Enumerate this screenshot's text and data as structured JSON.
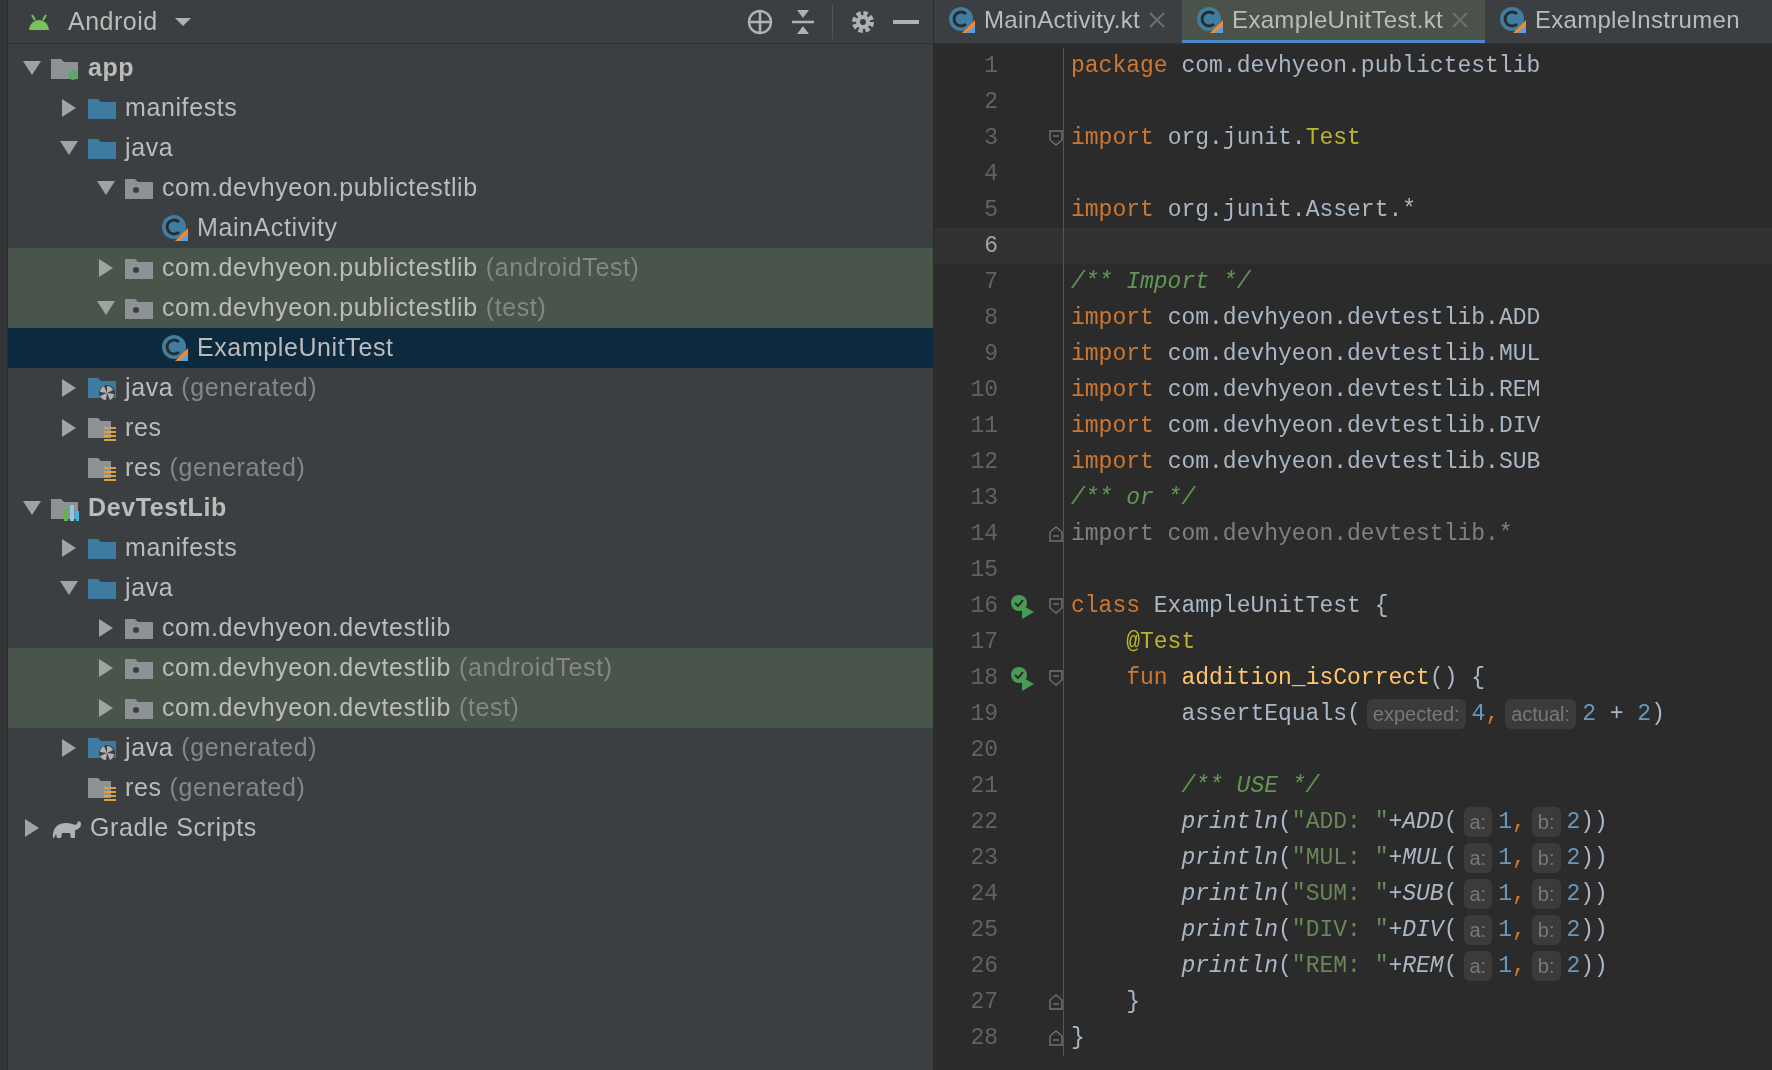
{
  "project_panel": {
    "view": "Android",
    "tree": [
      {
        "label": "app",
        "bold": true,
        "kind": "module",
        "expanded": true,
        "selected": false,
        "tinted": false,
        "children": [
          {
            "label": "manifests",
            "kind": "folder",
            "expanded": false,
            "selected": false,
            "tinted": false
          },
          {
            "label": "java",
            "kind": "folder",
            "expanded": true,
            "selected": false,
            "tinted": false,
            "children": [
              {
                "label": "com.devhyeon.publictestlib",
                "kind": "package",
                "expanded": true,
                "selected": false,
                "tinted": false,
                "children": [
                  {
                    "label": "MainActivity",
                    "kind": "class",
                    "selected": false,
                    "tinted": false
                  }
                ]
              },
              {
                "label": "com.devhyeon.publictestlib",
                "suffix": "(androidTest)",
                "kind": "package",
                "expanded": false,
                "selected": false,
                "tinted": true
              },
              {
                "label": "com.devhyeon.publictestlib",
                "suffix": "(test)",
                "kind": "package",
                "expanded": true,
                "selected": false,
                "tinted": true,
                "children": [
                  {
                    "label": "ExampleUnitTest",
                    "kind": "class",
                    "selected": true,
                    "tinted": false
                  }
                ]
              }
            ]
          },
          {
            "label": "java",
            "suffix": "(generated)",
            "kind": "generated",
            "expanded": false,
            "selected": false,
            "tinted": false
          },
          {
            "label": "res",
            "kind": "res",
            "expanded": false,
            "selected": false,
            "tinted": false
          },
          {
            "label": "res",
            "suffix": "(generated)",
            "kind": "res",
            "selected": false,
            "tinted": false
          }
        ]
      },
      {
        "label": "DevTestLib",
        "bold": true,
        "kind": "library",
        "expanded": true,
        "selected": false,
        "tinted": false,
        "children": [
          {
            "label": "manifests",
            "kind": "folder",
            "expanded": false,
            "selected": false,
            "tinted": false
          },
          {
            "label": "java",
            "kind": "folder",
            "expanded": true,
            "selected": false,
            "tinted": false,
            "children": [
              {
                "label": "com.devhyeon.devtestlib",
                "kind": "package",
                "expanded": false,
                "selected": false,
                "tinted": false
              },
              {
                "label": "com.devhyeon.devtestlib",
                "suffix": "(androidTest)",
                "kind": "package",
                "expanded": false,
                "selected": false,
                "tinted": true
              },
              {
                "label": "com.devhyeon.devtestlib",
                "suffix": "(test)",
                "kind": "package",
                "expanded": false,
                "selected": false,
                "tinted": true
              }
            ]
          },
          {
            "label": "java",
            "suffix": "(generated)",
            "kind": "generated",
            "expanded": false,
            "selected": false,
            "tinted": false
          },
          {
            "label": "res",
            "suffix": "(generated)",
            "kind": "res",
            "selected": false,
            "tinted": false
          }
        ]
      },
      {
        "label": "Gradle Scripts",
        "kind": "gradle",
        "expanded": false,
        "selected": false,
        "tinted": false
      }
    ]
  },
  "tabs": [
    {
      "label": "MainActivity.kt",
      "selected": false,
      "closable": true
    },
    {
      "label": "ExampleUnitTest.kt",
      "selected": true,
      "closable": true
    },
    {
      "label": "ExampleInstrumen",
      "selected": false,
      "closable": false
    }
  ],
  "editor": {
    "lines": [
      {
        "n": "1",
        "current": false,
        "tokens": [
          {
            "t": "package",
            "kind": "keyword"
          },
          {
            "t": "com.devhyeon.publictestlib",
            "kind": "plain"
          }
        ]
      },
      {
        "n": "2",
        "current": false
      },
      {
        "n": "3",
        "current": false,
        "fold_start": true,
        "tokens": [
          {
            "t": "import",
            "kind": "keyword"
          },
          {
            "t": "org.junit.",
            "kind": "plain"
          },
          {
            "t": "Test",
            "kind": "annotation"
          }
        ]
      },
      {
        "n": "4",
        "current": false
      },
      {
        "n": "5",
        "current": false,
        "tokens": [
          {
            "t": "import",
            "kind": "keyword"
          },
          {
            "t": "org.junit.Assert.*",
            "kind": "plain"
          }
        ]
      },
      {
        "n": "6",
        "current": true
      },
      {
        "n": "7",
        "current": false,
        "tokens": [
          {
            "t": "/** Import */",
            "kind": "comment"
          }
        ]
      },
      {
        "n": "8",
        "current": false,
        "tokens": [
          {
            "t": "import",
            "kind": "keyword"
          },
          {
            "t": "com.devhyeon.devtestlib.ADD",
            "kind": "plain"
          }
        ]
      },
      {
        "n": "9",
        "current": false,
        "tokens": [
          {
            "t": "import",
            "kind": "keyword"
          },
          {
            "t": "com.devhyeon.devtestlib.MUL",
            "kind": "plain"
          }
        ]
      },
      {
        "n": "10",
        "current": false,
        "tokens": [
          {
            "t": "import",
            "kind": "keyword"
          },
          {
            "t": "com.devhyeon.devtestlib.REM",
            "kind": "plain"
          }
        ]
      },
      {
        "n": "11",
        "current": false,
        "tokens": [
          {
            "t": "import",
            "kind": "keyword"
          },
          {
            "t": "com.devhyeon.devtestlib.DIV",
            "kind": "plain"
          }
        ]
      },
      {
        "n": "12",
        "current": false,
        "tokens": [
          {
            "t": "import",
            "kind": "keyword"
          },
          {
            "t": "com.devhyeon.devtestlib.SUB",
            "kind": "plain"
          }
        ]
      },
      {
        "n": "13",
        "current": false,
        "tokens": [
          {
            "t": "/** or */",
            "kind": "comment"
          }
        ]
      },
      {
        "n": "14",
        "current": false,
        "fold_end": true,
        "tokens": [
          {
            "t": "import com.devhyeon.devtestlib.*",
            "kind": "unused"
          }
        ]
      },
      {
        "n": "15",
        "current": false
      },
      {
        "n": "16",
        "current": false,
        "fold_start": true,
        "run": true,
        "tokens": [
          {
            "t": "class",
            "kind": "keyword"
          },
          {
            "t": "ExampleUnitTest {",
            "kind": "plain"
          }
        ],
        "children": [
          {
            "n": "17",
            "current": false,
            "tokens": [
              {
                "t": "@Test",
                "kind": "annotation"
              }
            ]
          },
          {
            "n": "18",
            "current": false,
            "fold_start": true,
            "run": true,
            "tokens": [
              {
                "t": "fun",
                "kind": "keyword"
              },
              {
                "t": "addition_isCorrect",
                "kind": "function"
              },
              {
                "t": "() {",
                "kind": "plain"
              }
            ],
            "children": [
              {
                "n": "19",
                "current": false,
                "tokens": [
                  {
                    "t": "assertEquals(",
                    "kind": "plain"
                  },
                  {
                    "t": "expected:",
                    "kind": "hint"
                  },
                  {
                    "t": "4",
                    "kind": "number"
                  },
                  {
                    "t": ",",
                    "kind": "punct"
                  },
                  {
                    "t": "actual:",
                    "kind": "hint"
                  },
                  {
                    "t": "2",
                    "kind": "number"
                  },
                  {
                    "t": "+",
                    "kind": "op"
                  },
                  {
                    "t": "2",
                    "kind": "number"
                  },
                  {
                    "t": ")",
                    "kind": "plain"
                  }
                ]
              },
              {
                "n": "20",
                "current": false
              },
              {
                "n": "21",
                "current": false,
                "tokens": [
                  {
                    "t": "/** USE */",
                    "kind": "comment"
                  }
                ]
              },
              {
                "n": "22",
                "current": false,
                "tokens": [
                  {
                    "t": "println",
                    "kind": "call"
                  },
                  {
                    "t": "(",
                    "kind": "plain"
                  },
                  {
                    "t": "\"ADD: \"",
                    "kind": "string"
                  },
                  {
                    "t": "+",
                    "kind": "plain"
                  },
                  {
                    "t": "ADD",
                    "kind": "call"
                  },
                  {
                    "t": "(",
                    "kind": "plain"
                  },
                  {
                    "t": "a:",
                    "kind": "hint"
                  },
                  {
                    "t": "1",
                    "kind": "number"
                  },
                  {
                    "t": ",",
                    "kind": "punct"
                  },
                  {
                    "t": "b:",
                    "kind": "hint"
                  },
                  {
                    "t": "2",
                    "kind": "number"
                  },
                  {
                    "t": "))",
                    "kind": "plain"
                  }
                ]
              },
              {
                "n": "23",
                "current": false,
                "tokens": [
                  {
                    "t": "println",
                    "kind": "call"
                  },
                  {
                    "t": "(",
                    "kind": "plain"
                  },
                  {
                    "t": "\"MUL: \"",
                    "kind": "string"
                  },
                  {
                    "t": "+",
                    "kind": "plain"
                  },
                  {
                    "t": "MUL",
                    "kind": "call"
                  },
                  {
                    "t": "(",
                    "kind": "plain"
                  },
                  {
                    "t": "a:",
                    "kind": "hint"
                  },
                  {
                    "t": "1",
                    "kind": "number"
                  },
                  {
                    "t": ",",
                    "kind": "punct"
                  },
                  {
                    "t": "b:",
                    "kind": "hint"
                  },
                  {
                    "t": "2",
                    "kind": "number"
                  },
                  {
                    "t": "))",
                    "kind": "plain"
                  }
                ]
              },
              {
                "n": "24",
                "current": false,
                "tokens": [
                  {
                    "t": "println",
                    "kind": "call"
                  },
                  {
                    "t": "(",
                    "kind": "plain"
                  },
                  {
                    "t": "\"SUM: \"",
                    "kind": "string"
                  },
                  {
                    "t": "+",
                    "kind": "plain"
                  },
                  {
                    "t": "SUB",
                    "kind": "call"
                  },
                  {
                    "t": "(",
                    "kind": "plain"
                  },
                  {
                    "t": "a:",
                    "kind": "hint"
                  },
                  {
                    "t": "1",
                    "kind": "number"
                  },
                  {
                    "t": ",",
                    "kind": "punct"
                  },
                  {
                    "t": "b:",
                    "kind": "hint"
                  },
                  {
                    "t": "2",
                    "kind": "number"
                  },
                  {
                    "t": "))",
                    "kind": "plain"
                  }
                ]
              },
              {
                "n": "25",
                "current": false,
                "tokens": [
                  {
                    "t": "println",
                    "kind": "call"
                  },
                  {
                    "t": "(",
                    "kind": "plain"
                  },
                  {
                    "t": "\"DIV: \"",
                    "kind": "string"
                  },
                  {
                    "t": "+",
                    "kind": "plain"
                  },
                  {
                    "t": "DIV",
                    "kind": "call"
                  },
                  {
                    "t": "(",
                    "kind": "plain"
                  },
                  {
                    "t": "a:",
                    "kind": "hint"
                  },
                  {
                    "t": "1",
                    "kind": "number"
                  },
                  {
                    "t": ",",
                    "kind": "punct"
                  },
                  {
                    "t": "b:",
                    "kind": "hint"
                  },
                  {
                    "t": "2",
                    "kind": "number"
                  },
                  {
                    "t": "))",
                    "kind": "plain"
                  }
                ]
              },
              {
                "n": "26",
                "current": false,
                "tokens": [
                  {
                    "t": "println",
                    "kind": "call"
                  },
                  {
                    "t": "(",
                    "kind": "plain"
                  },
                  {
                    "t": "\"REM: \"",
                    "kind": "string"
                  },
                  {
                    "t": "+",
                    "kind": "plain"
                  },
                  {
                    "t": "REM",
                    "kind": "call"
                  },
                  {
                    "t": "(",
                    "kind": "plain"
                  },
                  {
                    "t": "a:",
                    "kind": "hint"
                  },
                  {
                    "t": "1",
                    "kind": "number"
                  },
                  {
                    "t": ",",
                    "kind": "punct"
                  },
                  {
                    "t": "b:",
                    "kind": "hint"
                  },
                  {
                    "t": "2",
                    "kind": "number"
                  },
                  {
                    "t": "))",
                    "kind": "plain"
                  }
                ]
              }
            ]
          },
          {
            "n": "27",
            "current": false,
            "fold_end": true,
            "tokens": [
              {
                "t": "}",
                "kind": "plain"
              }
            ]
          }
        ]
      },
      {
        "n": "28",
        "current": false,
        "fold_end": true,
        "tokens": [
          {
            "t": "}",
            "kind": "plain"
          }
        ]
      }
    ]
  }
}
